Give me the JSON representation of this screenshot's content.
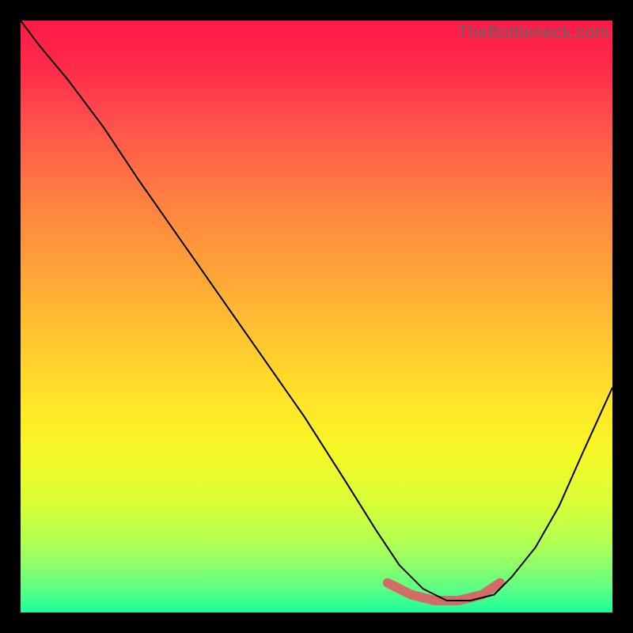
{
  "watermark": "TheBottleneck.com",
  "colors": {
    "bg": "#000000",
    "gradient_top": "#ff1a46",
    "gradient_bottom": "#1aff9c",
    "line": "#000000",
    "highlight": "#d36b67",
    "watermark": "#646464"
  },
  "chart_data": {
    "type": "line",
    "title": "",
    "xlabel": "",
    "ylabel": "",
    "xlim": [
      0,
      100
    ],
    "ylim": [
      0,
      100
    ],
    "note": "Axes are unlabeled; x and y normalized to 0–100. Curve read from pixel coordinates. y=0 at bottom (green) rising to y≈100 at top (red). Highlighted segment marks flat trough region.",
    "series": [
      {
        "name": "curve",
        "x": [
          0,
          3,
          8,
          14,
          20,
          27,
          34,
          41,
          48,
          55,
          60,
          64,
          68,
          72,
          76,
          80,
          83,
          87,
          91,
          95,
          100
        ],
        "y": [
          100,
          96,
          90,
          82,
          73,
          63,
          53,
          43,
          33,
          22,
          14,
          8,
          4,
          2,
          2,
          3,
          6,
          11,
          18,
          27,
          38
        ]
      }
    ],
    "highlight": {
      "name": "trough",
      "x": [
        62,
        66,
        70,
        74,
        78,
        81
      ],
      "y": [
        5,
        3,
        2,
        2,
        3,
        5
      ]
    }
  }
}
